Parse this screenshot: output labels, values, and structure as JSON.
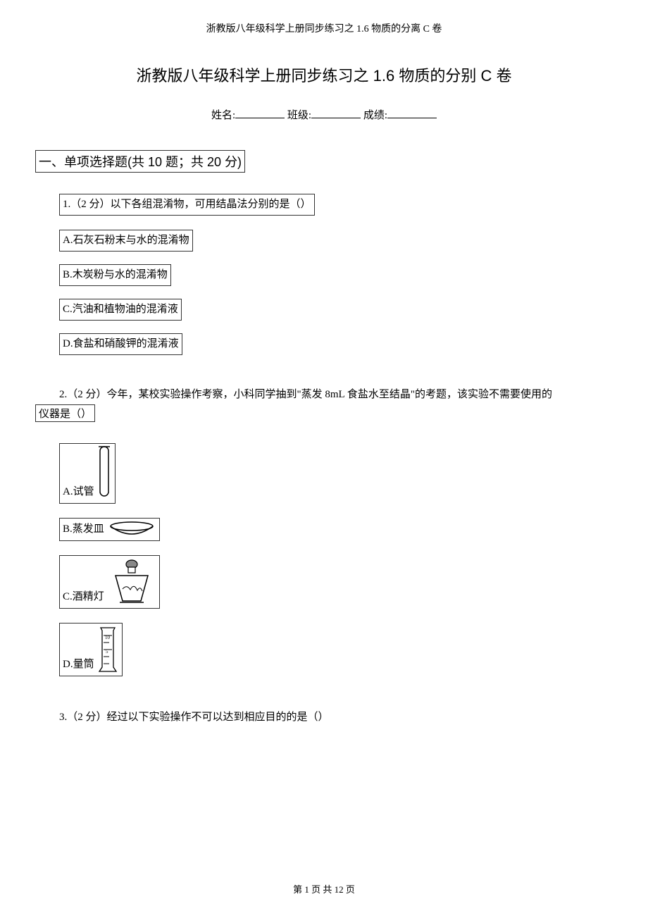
{
  "running_header": "浙教版八年级科学上册同步练习之 1.6 物质的分离 C 卷",
  "title": "浙教版八年级科学上册同步练习之 1.6 物质的分别 C 卷",
  "info": {
    "name_label": "姓名:",
    "class_label": "班级:",
    "score_label": "成绩:"
  },
  "section": "一、单项选择题(共 10 题；共 20 分)",
  "q1": {
    "stem": "1.（2 分）以下各组混淆物，可用结晶法分别的是（）",
    "a": "A.石灰石粉末与水的混淆物",
    "b": "B.木炭粉与水的混淆物",
    "c": "C.汽油和植物油的混淆液",
    "d": "D.食盐和硝酸钾的混淆液"
  },
  "q2": {
    "stem": "2.（2 分）今年，某校实验操作考察，小科同学抽到\"蒸发 8mL 食盐水至结晶\"的考题，该实验不需要使用的",
    "stem2": "仪器是（）",
    "a": "A.试管",
    "b": "B.蒸发皿",
    "c": "C.酒精灯",
    "d": "D.量筒"
  },
  "q3": {
    "stem": "3.（2 分）经过以下实验操作不可以达到相应目的的是（）"
  },
  "footer": "第 1 页 共 12 页"
}
